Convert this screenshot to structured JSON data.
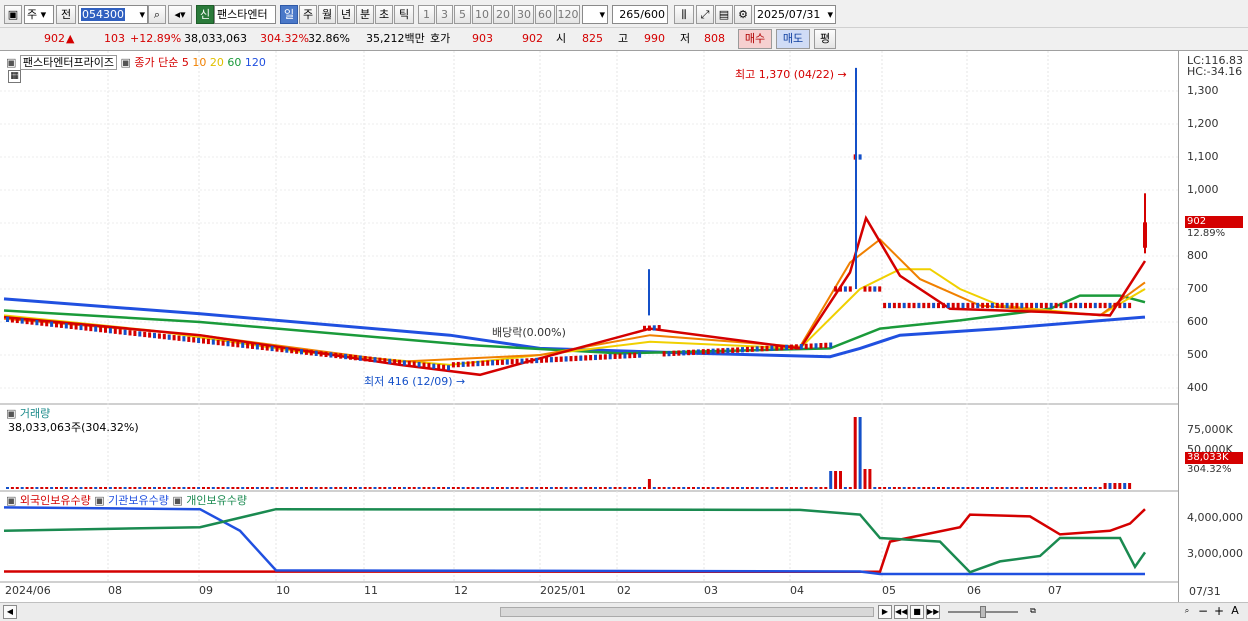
{
  "toolbar": {
    "type_sel": "주",
    "prefix": "전",
    "code": "054300",
    "badge": "신",
    "stock_name": "팬스타엔터",
    "periods": [
      "일",
      "주",
      "월",
      "년",
      "분",
      "초",
      "틱"
    ],
    "active_period": "일",
    "intervals": [
      "1",
      "3",
      "5",
      "10",
      "20",
      "30",
      "60",
      "120"
    ],
    "count": "265",
    "count_total": "/600",
    "date": "2025/07/31"
  },
  "quote": {
    "price": "902",
    "arrow": "▲",
    "change": "103",
    "change_pct": "+12.89%",
    "volume": "38,033,063",
    "vol_ratio": "304.32%",
    "turnover": "32.86%",
    "trade_value": "35,212백만",
    "hoga_label": "호가",
    "ask": "903",
    "bid": "902",
    "open_label": "시",
    "open": "825",
    "high_label": "고",
    "high": "990",
    "low_label": "저",
    "low": "808",
    "buy_label": "매수",
    "sell_label": "매도",
    "eval_label": "평"
  },
  "price_panel": {
    "legend_name": "팬스타엔터프라이즈",
    "legend_type": "종가 단순",
    "ma_periods": [
      "5",
      "10",
      "20",
      "60",
      "120"
    ],
    "ma_colors": [
      "#d40000",
      "#f08000",
      "#f0d000",
      "#1a9a3a",
      "#2050e0"
    ],
    "lc_label": "LC:116.83",
    "hc_label": "HC:-34.16",
    "max_annotation": "최고 1,370 (04/22)",
    "min_annotation": "최저 416 (12/09)",
    "dividend_annotation": "배당락(0.00%)",
    "last_price_tag": "902",
    "last_pct_tag": "12.89%",
    "y_ticks": [
      "1,300",
      "1,200",
      "1,100",
      "1,000",
      "900",
      "800",
      "700",
      "600",
      "500",
      "400"
    ]
  },
  "volume_panel": {
    "title": "거래량",
    "value_text": "38,033,063주(304.32%)",
    "y_ticks": [
      "75,000K",
      "50,000K"
    ],
    "last_tag": "38,033K",
    "last_pct": "304.32%"
  },
  "holdings_panel": {
    "series": [
      "외국인보유수량",
      "기관보유수량",
      "개인보유수량"
    ],
    "colors": [
      "#d40000",
      "#2050e0",
      "#1a8a50"
    ],
    "y_ticks": [
      "4,000,000",
      "3,000,000"
    ]
  },
  "x_axis": {
    "labels": [
      "2024/06",
      "08",
      "09",
      "10",
      "11",
      "12",
      "2025/01",
      "02",
      "03",
      "04",
      "05",
      "06",
      "07"
    ],
    "last_label": "07/31"
  }
}
